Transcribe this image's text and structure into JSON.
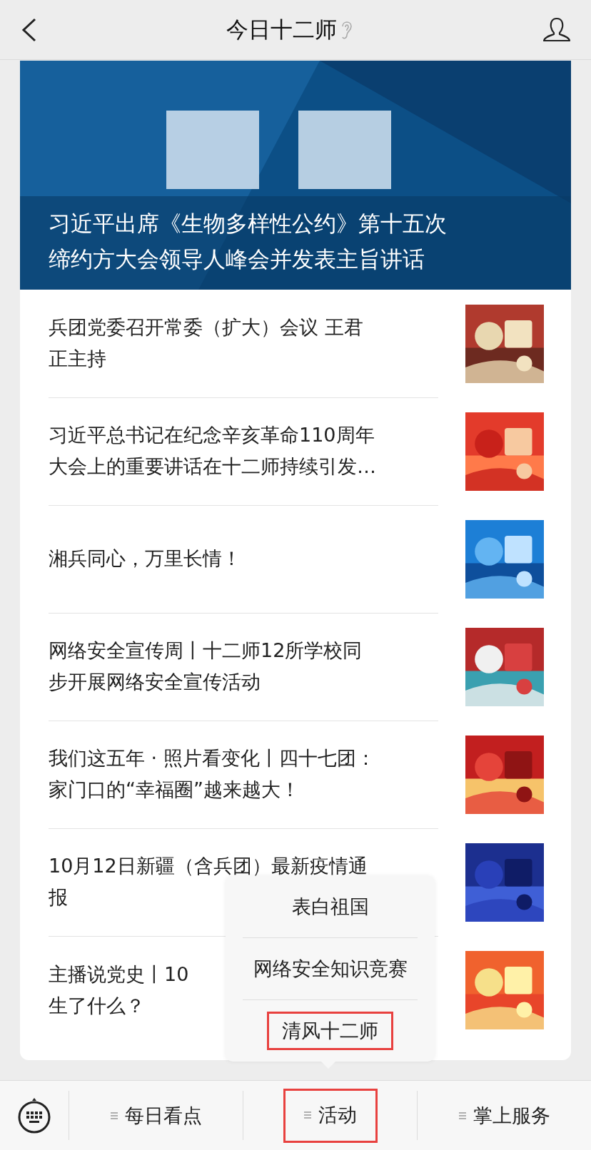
{
  "header": {
    "title": "今日十二师"
  },
  "banner": {
    "kind": "picture",
    "lines": [
      "习近平出席《生物多样性公约》第十五次",
      "缔约方大会领导人峰会并发表主旨讲话"
    ]
  },
  "news": [
    {
      "lines": [
        "兵团党委召开常委（扩大）会议 王君",
        "正主持"
      ],
      "thumbnail": {
        "kind": "picture"
      }
    },
    {
      "lines": [
        "习近平总书记在纪念辛亥革命110周年",
        "大会上的重要讲话在十二师持续引发…"
      ],
      "thumbnail": {
        "kind": "picture"
      }
    },
    {
      "lines": [
        "湘兵同心，万里长情！"
      ],
      "thumbnail": {
        "kind": "picture"
      }
    },
    {
      "lines": [
        "网络安全宣传周丨十二师12所学校同",
        "步开展网络安全宣传活动"
      ],
      "thumbnail": {
        "kind": "picture"
      }
    },
    {
      "lines": [
        "我们这五年 · 照片看变化丨四十七团：",
        "家门口的“幸福圈”越来越大！"
      ],
      "thumbnail": {
        "kind": "picture"
      }
    },
    {
      "lines": [
        "10月12日新疆（含兵团）最新疫情通",
        "报"
      ],
      "thumbnail": {
        "kind": "picture"
      }
    },
    {
      "lines": [
        "主播说党史丨10",
        "生了什么？"
      ],
      "thumbnail": {
        "kind": "picture"
      }
    }
  ],
  "popup_menu": {
    "items": [
      {
        "label": "表白祖国",
        "highlighted": false
      },
      {
        "label": "网络安全知识竞赛",
        "highlighted": false
      },
      {
        "label": "清风十二师",
        "highlighted": true
      }
    ]
  },
  "bottom_menu": {
    "items": [
      {
        "label": "每日看点",
        "highlighted": false
      },
      {
        "label": "活动",
        "highlighted": true
      },
      {
        "label": "掌上服务",
        "highlighted": false
      }
    ]
  }
}
